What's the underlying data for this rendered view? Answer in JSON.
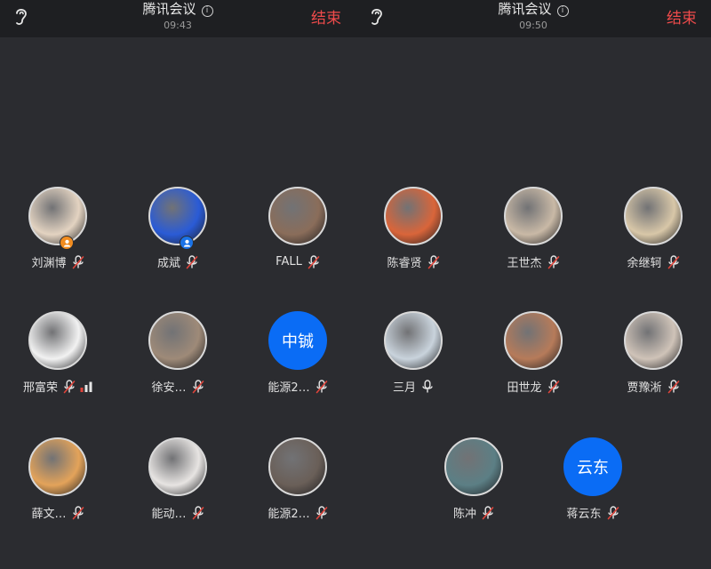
{
  "left_screen": {
    "title": "腾讯会议",
    "time": "09:43",
    "end_label": "结束",
    "participants": [
      {
        "name": "刘渊博",
        "avatar_text": "",
        "avatar_color": "#e3d3c1",
        "badge": "host-orange",
        "muted": true
      },
      {
        "name": "成斌",
        "avatar_text": "",
        "avatar_color": "#2a5bd6",
        "badge": "cohost-blue",
        "muted": true
      },
      {
        "name": "FALL",
        "avatar_text": "",
        "avatar_color": "#8a6d5a",
        "badge": "",
        "muted": true
      },
      {
        "name": "邢富荣",
        "avatar_text": "",
        "avatar_color": "#f2f2f2",
        "badge": "",
        "muted": true,
        "signal": true
      },
      {
        "name": "徐安…",
        "avatar_text": "",
        "avatar_color": "#9e8a78",
        "badge": "",
        "muted": true
      },
      {
        "name": "能源2…",
        "avatar_text": "中铖",
        "avatar_color": "#0a6cf5",
        "badge": "",
        "muted": true
      },
      {
        "name": "薛文…",
        "avatar_text": "",
        "avatar_color": "#e3a35a",
        "badge": "",
        "muted": true
      },
      {
        "name": "能动…",
        "avatar_text": "",
        "avatar_color": "#e7e4e2",
        "badge": "",
        "muted": true
      },
      {
        "name": "能源2…",
        "avatar_text": "",
        "avatar_color": "#6a5f58",
        "badge": "",
        "muted": true
      }
    ]
  },
  "right_screen": {
    "title": "腾讯会议",
    "time": "09:50",
    "end_label": "结束",
    "participants": [
      {
        "name": "陈睿贤",
        "avatar_text": "",
        "avatar_color": "#d9653a",
        "badge": "",
        "muted": true
      },
      {
        "name": "王世杰",
        "avatar_text": "",
        "avatar_color": "#c9b9a6",
        "badge": "",
        "muted": true
      },
      {
        "name": "余继轲",
        "avatar_text": "",
        "avatar_color": "#d8c7a8",
        "badge": "",
        "muted": true
      },
      {
        "name": "三月",
        "avatar_text": "",
        "avatar_color": "#c9d3dc",
        "badge": "",
        "muted": false
      },
      {
        "name": "田世龙",
        "avatar_text": "",
        "avatar_color": "#b67b5a",
        "badge": "",
        "muted": true
      },
      {
        "name": "贾豫淅",
        "avatar_text": "",
        "avatar_color": "#cfc3b8",
        "badge": "",
        "muted": true
      },
      {
        "name": "陈冲",
        "avatar_text": "",
        "avatar_color": "#5c7f85",
        "badge": "",
        "muted": true
      },
      {
        "name": "蒋云东",
        "avatar_text": "云东",
        "avatar_color": "#0a6cf5",
        "badge": "",
        "muted": true
      }
    ]
  },
  "colors": {
    "end_red": "#f04b4b",
    "mic_muted_red": "#e0443b",
    "signal_red": "#e0443b",
    "host_badge_orange": "#f28c1f",
    "cohost_badge_blue": "#1a73e8"
  }
}
